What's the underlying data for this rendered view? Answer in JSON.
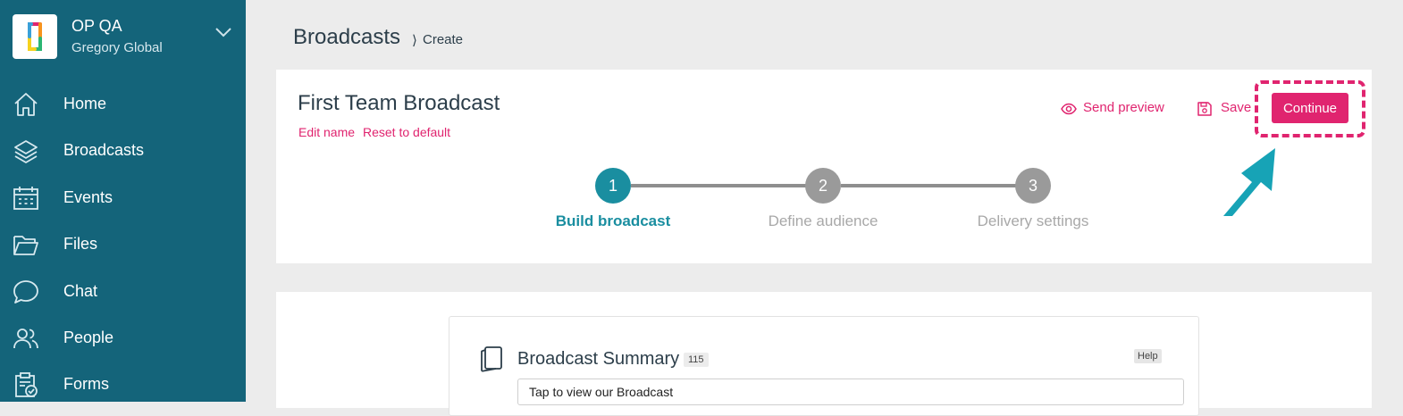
{
  "sidebar": {
    "org_name": "OP QA",
    "org_sub": "Gregory Global",
    "items": [
      {
        "label": "Home",
        "icon": "home-icon"
      },
      {
        "label": "Broadcasts",
        "icon": "layers-icon"
      },
      {
        "label": "Events",
        "icon": "calendar-icon"
      },
      {
        "label": "Files",
        "icon": "folder-icon"
      },
      {
        "label": "Chat",
        "icon": "chat-bubble-icon"
      },
      {
        "label": "People",
        "icon": "people-icon"
      },
      {
        "label": "Forms",
        "icon": "clipboard-check-icon"
      }
    ]
  },
  "breadcrumb": {
    "root": "Broadcasts",
    "separator": "⟩",
    "current": "Create"
  },
  "broadcast": {
    "name": "First Team Broadcast",
    "edit_name": "Edit name",
    "reset": "Reset to default",
    "send_preview": "Send preview",
    "save": "Save",
    "continue": "Continue"
  },
  "steps": [
    {
      "number": "1",
      "label": "Build broadcast",
      "active": true
    },
    {
      "number": "2",
      "label": "Define audience",
      "active": false
    },
    {
      "number": "3",
      "label": "Delivery settings",
      "active": false
    }
  ],
  "summary": {
    "title": "Broadcast Summary",
    "count": "115",
    "help": "Help",
    "value": "Tap to view our Broadcast"
  },
  "colors": {
    "sidebar": "#14647a",
    "accent": "#e0246f",
    "step_active": "#1a8ea0",
    "step_inactive": "#9a9a9a",
    "arrow": "#17a3b6"
  }
}
